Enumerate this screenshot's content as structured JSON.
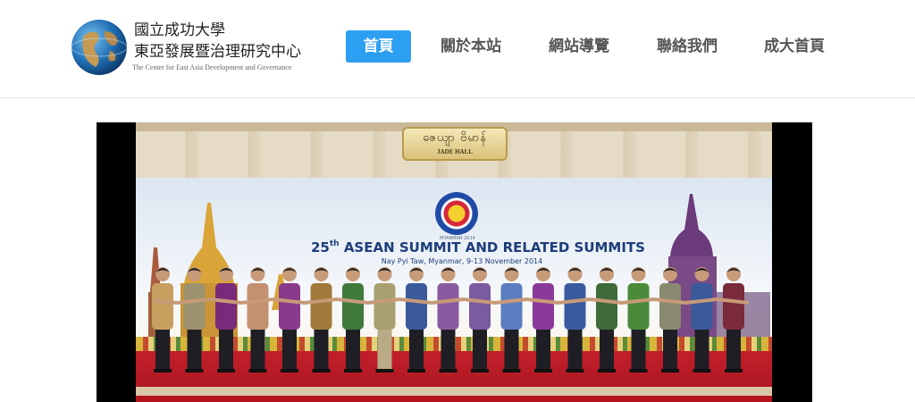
{
  "header": {
    "title_line1": "國立成功大學",
    "title_line2": "東亞發展暨治理研究中心",
    "title_en": "The Center for East Asia Development and Governance"
  },
  "nav": {
    "items": [
      {
        "label": "首頁",
        "active": true
      },
      {
        "label": "關於本站",
        "active": false
      },
      {
        "label": "網站導覽",
        "active": false
      },
      {
        "label": "聯絡我們",
        "active": false
      },
      {
        "label": "成大首頁",
        "active": false
      }
    ],
    "active_color": "#2d9ff2"
  },
  "hero": {
    "sign_script": "ဇေယျာ ဗိမာန်",
    "sign_label": "JADE HALL",
    "event_year_label": "MYANMAR 2014",
    "title_num": "25",
    "title_sup": "th",
    "title_rest": " ASEAN SUMMIT AND RELATED SUMMITS",
    "subtitle": "Nay Pyi Taw, Myanmar, 9-13 November 2014",
    "shirt_colors": [
      "#c7a060",
      "#9d9270",
      "#7a2a7a",
      "#c39070",
      "#8a3a8c",
      "#a07a3a",
      "#3f7a3a",
      "#a8a070",
      "#3a5a9a",
      "#8a5aa0",
      "#7a5aa0",
      "#5a7ec0",
      "#8a3a9a",
      "#3a5aa0",
      "#3f6a3a",
      "#4a8a3a",
      "#8a8a70",
      "#3a5a9a",
      "#7a2a3a"
    ]
  }
}
